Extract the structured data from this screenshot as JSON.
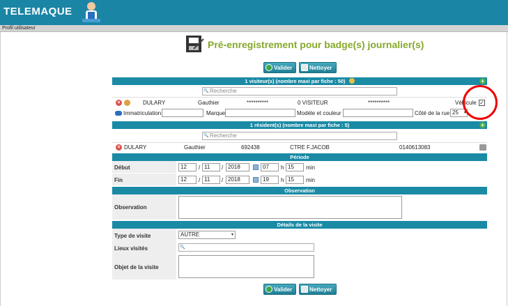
{
  "header": {
    "logo": "TELEMAQUE",
    "tab": "Profil utilisateur"
  },
  "page": {
    "title": "Pré-enregistrement pour badge(s) journalier(s)"
  },
  "buttons": {
    "valider": "Valider",
    "nettoyer": "Nettoyer"
  },
  "visitors": {
    "header": "1 visiteur(s) (nombre maxi par fiche : 50)",
    "search_placeholder": "Recherche",
    "row": {
      "lastname": "DULARY",
      "firstname": "Gauthier",
      "masked1": "**********",
      "type": "0 VISITEUR",
      "masked2": "**********",
      "vehicle_label": "Véhicule",
      "vehicle_checked": "✓"
    },
    "vehicle": {
      "immat_label": "Immatriculation",
      "marque_label": "Marque",
      "modele_label": "Modèle et couleur",
      "cote_label": "Côté de la rue",
      "cote_value": "25"
    }
  },
  "residents": {
    "header": "1 résident(s) (nombre maxi par fiche : 5)",
    "search_placeholder": "Recherche",
    "row": {
      "lastname": "DULARY",
      "firstname": "Gauthier",
      "id": "692438",
      "site": "CTRE F.JACOB",
      "phone": "0140613083"
    }
  },
  "periode": {
    "header": "Période",
    "debut": {
      "label": "Début",
      "day": "12",
      "month": "11",
      "year": "2018",
      "hour": "07",
      "min": "15"
    },
    "fin": {
      "label": "Fin",
      "day": "12",
      "month": "11",
      "year": "2018",
      "hour": "19",
      "min": "15"
    },
    "slash": "/",
    "h": "h",
    "min_label": "min"
  },
  "observation": {
    "header": "Observation",
    "label": "Observation"
  },
  "details": {
    "header": "Détails de la visite",
    "type_label": "Type de visite",
    "type_value": "AUTRE",
    "lieux_label": "Lieux visités",
    "objet_label": "Objet de la visite"
  }
}
